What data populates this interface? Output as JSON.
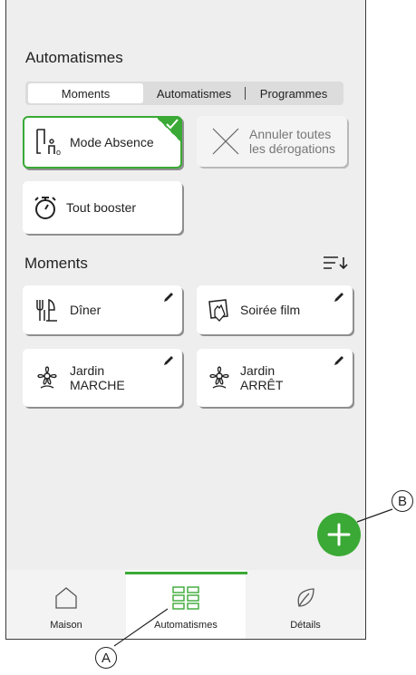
{
  "header": {
    "title": "Automatismes"
  },
  "tabs": [
    {
      "label": "Moments",
      "active": true
    },
    {
      "label": "Automatismes",
      "active": false
    },
    {
      "label": "Programmes",
      "active": false
    }
  ],
  "quick_actions": {
    "mode_absence": {
      "label": "Mode Absence",
      "selected": true
    },
    "cancel_overrides": {
      "label_line1": "Annuler toutes",
      "label_line2": "les dérogations",
      "enabled": false
    },
    "boost_all": {
      "label": "Tout booster"
    }
  },
  "moments": {
    "title": "Moments",
    "items": [
      {
        "label_line1": "Dîner",
        "label_line2": "",
        "icon": "fork-knife-icon"
      },
      {
        "label_line1": "Soirée film",
        "label_line2": "",
        "icon": "tv-hand-icon"
      },
      {
        "label_line1": "Jardin",
        "label_line2": "MARCHE",
        "icon": "flower-icon"
      },
      {
        "label_line1": "Jardin",
        "label_line2": "ARRÊT",
        "icon": "flower-icon"
      }
    ]
  },
  "bottom_nav": [
    {
      "label": "Maison",
      "icon": "house-icon"
    },
    {
      "label": "Automatismes",
      "icon": "grid-icon",
      "active": true
    },
    {
      "label": "Détails",
      "icon": "leaf-icon"
    }
  ],
  "callouts": {
    "a": "A",
    "b": "B"
  },
  "colors": {
    "accent": "#3aa935",
    "background": "#eeeeee",
    "tile": "#ffffff"
  }
}
